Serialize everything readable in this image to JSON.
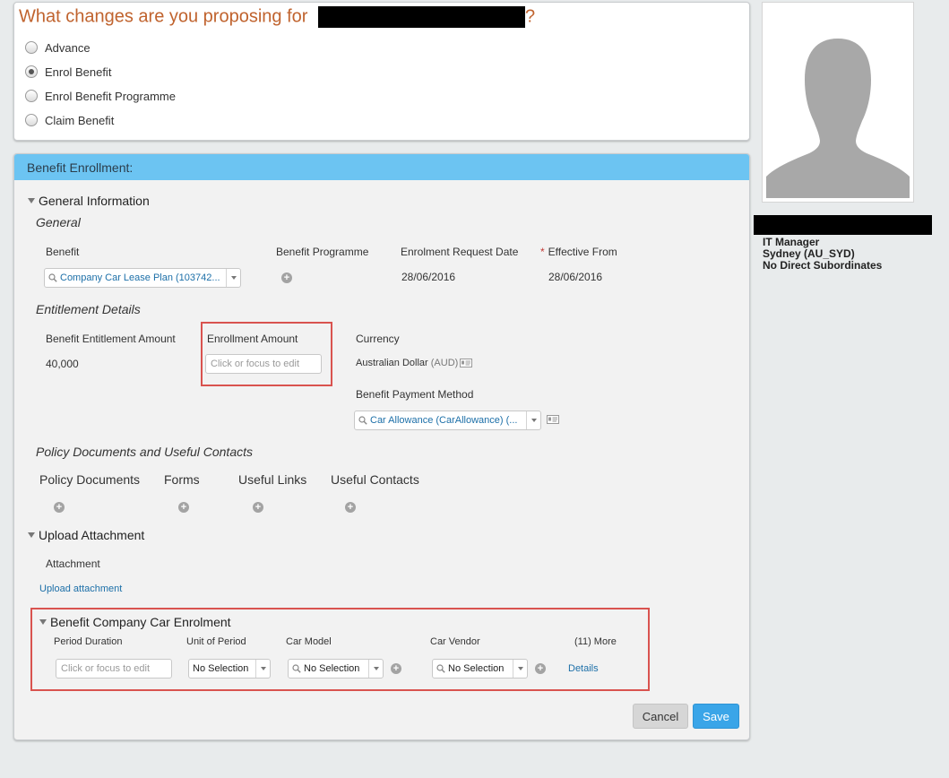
{
  "proposal": {
    "title_prefix": "What changes are you proposing for",
    "title_suffix": "?",
    "options": [
      {
        "label": "Advance",
        "checked": false
      },
      {
        "label": "Enrol Benefit",
        "checked": true
      },
      {
        "label": "Enrol Benefit Programme",
        "checked": false
      },
      {
        "label": "Claim Benefit",
        "checked": false
      }
    ]
  },
  "panel": {
    "header": "Benefit Enrollment:",
    "general_information": {
      "title": "General Information",
      "general_title": "General",
      "benefit_label": "Benefit",
      "benefit_value": "Company Car Lease Plan (103742...",
      "programme_label": "Benefit Programme",
      "request_date_label": "Enrolment Request Date",
      "request_date_value": "28/06/2016",
      "effective_required": "*",
      "effective_label": "Effective From",
      "effective_value": "28/06/2016",
      "entitlement_title": "Entitlement Details",
      "entitlement_amount_label": "Benefit Entitlement Amount",
      "entitlement_amount_value": "40,000",
      "enrollment_amount_label": "Enrollment Amount",
      "enrollment_amount_placeholder": "Click or focus to edit",
      "currency_label": "Currency",
      "currency_value": "Australian Dollar",
      "currency_code": "(AUD)",
      "payment_method_label": "Benefit Payment Method",
      "payment_method_value": "Car Allowance (CarAllowance) (...",
      "policy_title": "Policy Documents and Useful Contacts",
      "policy_tabs": [
        "Policy Documents",
        "Forms",
        "Useful Links",
        "Useful Contacts"
      ]
    },
    "upload": {
      "title": "Upload Attachment",
      "attachment_label": "Attachment",
      "upload_link": "Upload attachment"
    },
    "car_enrolment": {
      "title": "Benefit Company Car Enrolment",
      "columns": [
        "Period Duration",
        "Unit of Period",
        "Car Model",
        "Car Vendor",
        "(11) More"
      ],
      "period_placeholder": "Click or focus to edit",
      "unit_value": "No Selection",
      "model_value": "No Selection",
      "vendor_value": "No Selection",
      "details_link": "Details"
    },
    "buttons": {
      "cancel": "Cancel",
      "save": "Save"
    }
  },
  "profile": {
    "role": "IT Manager",
    "location": "Sydney (AU_SYD)",
    "subordinates": "No Direct Subordinates"
  },
  "icons": {
    "avatar": "person-silhouette-icon",
    "plus": "plus-circle-icon",
    "card": "contact-card-icon",
    "search": "magnifier-icon",
    "caret": "caret-down-icon"
  },
  "colors": {
    "title": "#c0632e",
    "panel_header": "#6cc4f2",
    "highlight": "#d9534f",
    "link": "#1c6fa8",
    "save": "#3aa5e8"
  }
}
